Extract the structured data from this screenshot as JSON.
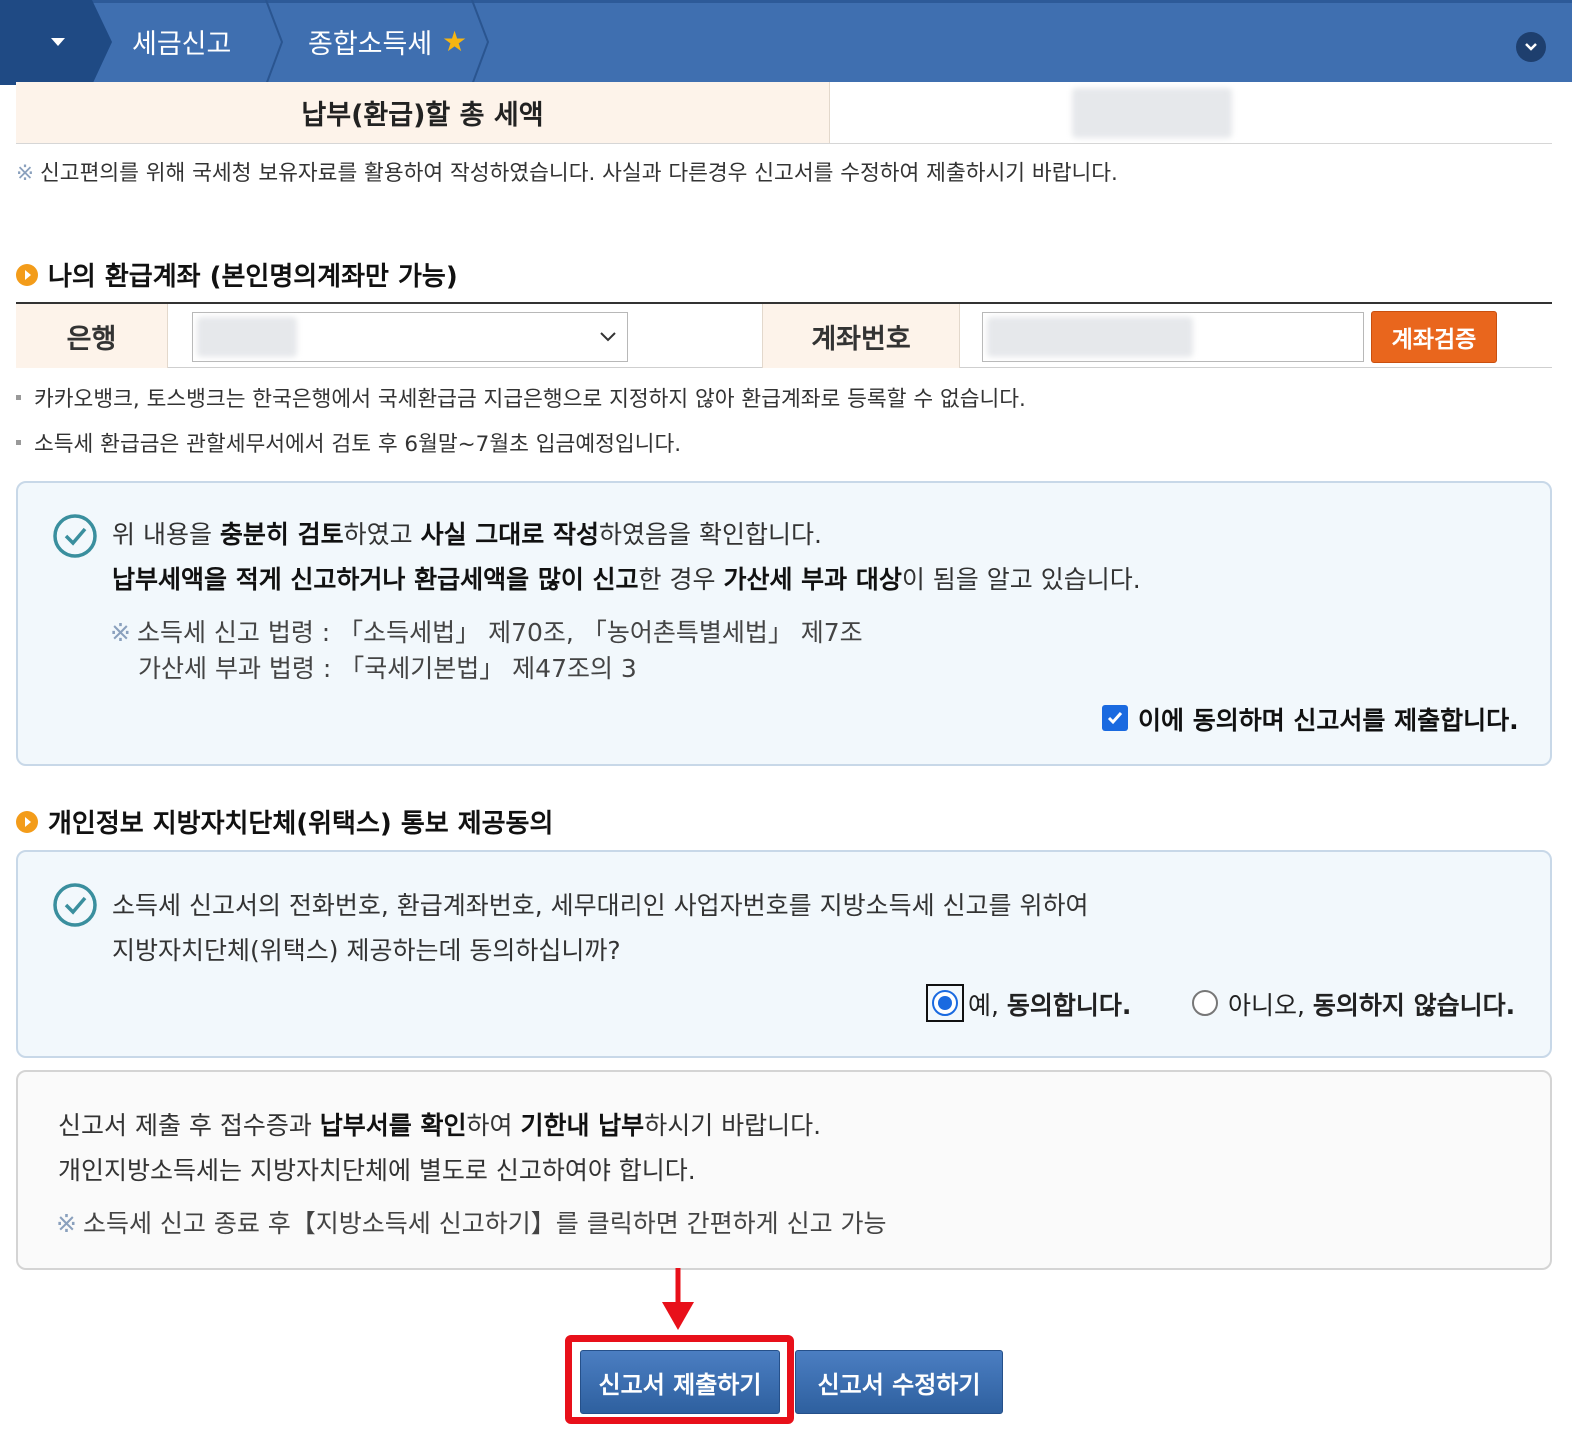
{
  "nav": {
    "crumb1": "세금신고",
    "crumb2": "종합소득세"
  },
  "total": {
    "label": "납부(환급)할 총 세액"
  },
  "notice": "신고편의를 위해 국세청 보유자료를 활용하여 작성하였습니다. 사실과 다른경우 신고서를 수정하여 제출하시기 바랍니다.",
  "refund_section": {
    "title": "나의 환급계좌 (본인명의계좌만 가능)",
    "bank_label": "은행",
    "account_label": "계좌번호",
    "verify_button": "계좌검증",
    "notes": [
      "카카오뱅크, 토스뱅크는 한국은행에서 국세환급금 지급은행으로 지정하지 않아 환급계좌로 등록할 수 없습니다.",
      "소득세 환급금은 관할세무서에서 검토 후 6월말~7월초 입금예정입니다."
    ]
  },
  "confirm_box": {
    "line1": {
      "t1": "위 내용을 ",
      "b1": "충분히 검토",
      "t2": "하였고 ",
      "b2": "사실 그대로 작성",
      "t3": "하였음을 확인합니다."
    },
    "line2": {
      "b1": "납부세액을 적게 신고하거나 환급세액을 많이 신고",
      "t1": "한 경우 ",
      "b2": "가산세 부과 대상",
      "t2": "이 됨을 알고 있습니다."
    },
    "law1": "소득세 신고 법령 : 「소득세법」 제70조, 「농어촌특별세법」 제7조",
    "law2": "가산세 부과 법령 : 「국세기본법」 제47조의 3",
    "agree_label": "이에 동의하며 신고서를 제출합니다.",
    "agree_checked": true
  },
  "privacy_section": {
    "title": "개인정보 지방자치단체(위택스) 통보 제공동의",
    "line1": "소득세 신고서의 전화번호, 환급계좌번호, 세무대리인 사업자번호를 지방소득세 신고를 위하여",
    "line2": "지방자치단체(위택스) 제공하는데 동의하십니까?",
    "yes_prefix": "예, ",
    "yes_bold": "동의합니다.",
    "no_prefix": "아니오, ",
    "no_bold": "동의하지 않습니다.",
    "selected": "yes"
  },
  "info_box": {
    "line1": {
      "t1": "신고서 제출 후 접수증과 ",
      "b1": "납부서를 확인",
      "t2": "하여 ",
      "b2": "기한내 납부",
      "t3": "하시기 바랍니다."
    },
    "line2": "개인지방소득세는 지방자치단체에 별도로 신고하여야 합니다.",
    "line3": "소득세 신고 종료 후【지방소득세 신고하기】를 클릭하면 간편하게 신고 가능"
  },
  "buttons": {
    "submit": "신고서 제출하기",
    "edit": "신고서 수정하기"
  },
  "colors": {
    "nav_bg": "#3f6fb0",
    "label_bg": "#fdf3ea",
    "verify_btn": "#e9661d",
    "highlight": "#e8101a",
    "checkbox": "#1a6ae0"
  }
}
